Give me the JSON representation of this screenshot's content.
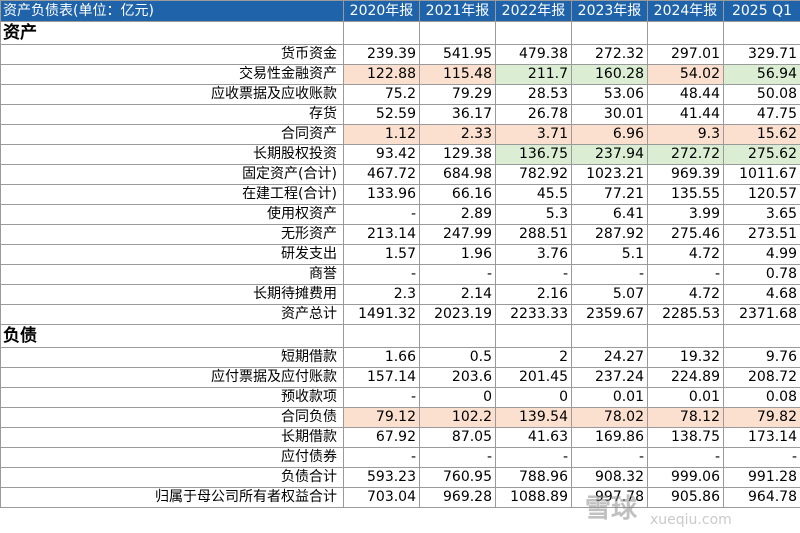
{
  "table": {
    "title": "资产负债表(单位：亿元)",
    "columns": [
      "2020年报",
      "2021年报",
      "2022年报",
      "2023年报",
      "2024年报",
      "2025 Q1"
    ],
    "sections": [
      {
        "heading": "资产",
        "rows": [
          {
            "label": "货币资金",
            "values": [
              "239.39",
              "541.95",
              "479.38",
              "272.32",
              "297.01",
              "329.71"
            ],
            "highlight": [
              "",
              "",
              "",
              "",
              "",
              ""
            ]
          },
          {
            "label": "交易性金融资产",
            "values": [
              "122.88",
              "115.48",
              "211.7",
              "160.28",
              "54.02",
              "56.94"
            ],
            "highlight": [
              "orange",
              "orange",
              "green",
              "green",
              "orange",
              "green"
            ]
          },
          {
            "label": "应收票据及应收账款",
            "values": [
              "75.2",
              "79.29",
              "28.53",
              "53.06",
              "48.44",
              "50.08"
            ],
            "highlight": [
              "",
              "",
              "",
              "",
              "",
              ""
            ]
          },
          {
            "label": "存货",
            "values": [
              "52.59",
              "36.17",
              "26.78",
              "30.01",
              "41.44",
              "47.75"
            ],
            "highlight": [
              "",
              "",
              "",
              "",
              "",
              ""
            ]
          },
          {
            "label": "合同资产",
            "values": [
              "1.12",
              "2.33",
              "3.71",
              "6.96",
              "9.3",
              "15.62"
            ],
            "highlight": [
              "orange",
              "orange",
              "orange",
              "orange",
              "orange",
              "orange"
            ]
          },
          {
            "label": "长期股权投资",
            "values": [
              "93.42",
              "129.38",
              "136.75",
              "237.94",
              "272.72",
              "275.62"
            ],
            "highlight": [
              "",
              "",
              "green",
              "green",
              "green",
              "green"
            ]
          },
          {
            "label": "固定资产(合计)",
            "values": [
              "467.72",
              "684.98",
              "782.92",
              "1023.21",
              "969.39",
              "1011.67"
            ],
            "highlight": [
              "",
              "",
              "",
              "",
              "",
              ""
            ]
          },
          {
            "label": "在建工程(合计)",
            "values": [
              "133.96",
              "66.16",
              "45.5",
              "77.21",
              "135.55",
              "120.57"
            ],
            "highlight": [
              "",
              "",
              "",
              "",
              "",
              ""
            ]
          },
          {
            "label": "使用权资产",
            "values": [
              "-",
              "2.89",
              "5.3",
              "6.41",
              "3.99",
              "3.65"
            ],
            "highlight": [
              "",
              "",
              "",
              "",
              "",
              ""
            ]
          },
          {
            "label": "无形资产",
            "values": [
              "213.14",
              "247.99",
              "288.51",
              "287.92",
              "275.46",
              "273.51"
            ],
            "highlight": [
              "",
              "",
              "",
              "",
              "",
              ""
            ]
          },
          {
            "label": "研发支出",
            "values": [
              "1.57",
              "1.96",
              "3.76",
              "5.1",
              "4.72",
              "4.99"
            ],
            "highlight": [
              "",
              "",
              "",
              "",
              "",
              ""
            ]
          },
          {
            "label": "商誉",
            "values": [
              "-",
              "-",
              "-",
              "-",
              "-",
              "0.78"
            ],
            "highlight": [
              "",
              "",
              "",
              "",
              "",
              ""
            ]
          },
          {
            "label": "长期待摊费用",
            "values": [
              "2.3",
              "2.14",
              "2.16",
              "5.07",
              "4.72",
              "4.68"
            ],
            "highlight": [
              "",
              "",
              "",
              "",
              "",
              ""
            ]
          },
          {
            "label": "资产总计",
            "values": [
              "1491.32",
              "2023.19",
              "2233.33",
              "2359.67",
              "2285.53",
              "2371.68"
            ],
            "highlight": [
              "",
              "",
              "",
              "",
              "",
              ""
            ]
          }
        ]
      },
      {
        "heading": "负债",
        "rows": [
          {
            "label": "短期借款",
            "values": [
              "1.66",
              "0.5",
              "2",
              "24.27",
              "19.32",
              "9.76"
            ],
            "highlight": [
              "",
              "",
              "",
              "",
              "",
              ""
            ]
          },
          {
            "label": "应付票据及应付账款",
            "values": [
              "157.14",
              "203.6",
              "201.45",
              "237.24",
              "224.89",
              "208.72"
            ],
            "highlight": [
              "",
              "",
              "",
              "",
              "",
              ""
            ]
          },
          {
            "label": "预收款项",
            "values": [
              "-",
              "0",
              "0",
              "0.01",
              "0.01",
              "0.08"
            ],
            "highlight": [
              "",
              "",
              "",
              "",
              "",
              ""
            ]
          },
          {
            "label": "合同负债",
            "values": [
              "79.12",
              "102.2",
              "139.54",
              "78.02",
              "78.12",
              "79.82"
            ],
            "highlight": [
              "orange",
              "orange",
              "orange",
              "orange",
              "orange",
              "orange"
            ]
          },
          {
            "label": "长期借款",
            "values": [
              "67.92",
              "87.05",
              "41.63",
              "169.86",
              "138.75",
              "173.14"
            ],
            "highlight": [
              "",
              "",
              "",
              "",
              "",
              ""
            ]
          },
          {
            "label": "应付债券",
            "values": [
              "-",
              "-",
              "-",
              "-",
              "-",
              "-"
            ],
            "highlight": [
              "",
              "",
              "",
              "",
              "",
              ""
            ]
          },
          {
            "label": "负债合计",
            "values": [
              "593.23",
              "760.95",
              "788.96",
              "908.32",
              "999.06",
              "991.28"
            ],
            "highlight": [
              "",
              "",
              "",
              "",
              "",
              ""
            ]
          },
          {
            "label": "归属于母公司所有者权益合计",
            "values": [
              "703.04",
              "969.28",
              "1088.89",
              "997.78",
              "905.86",
              "964.78"
            ],
            "highlight": [
              "",
              "",
              "",
              "",
              "",
              ""
            ]
          }
        ]
      }
    ]
  },
  "watermark": {
    "text": "雪球",
    "subtext": "xueqiu.com"
  }
}
